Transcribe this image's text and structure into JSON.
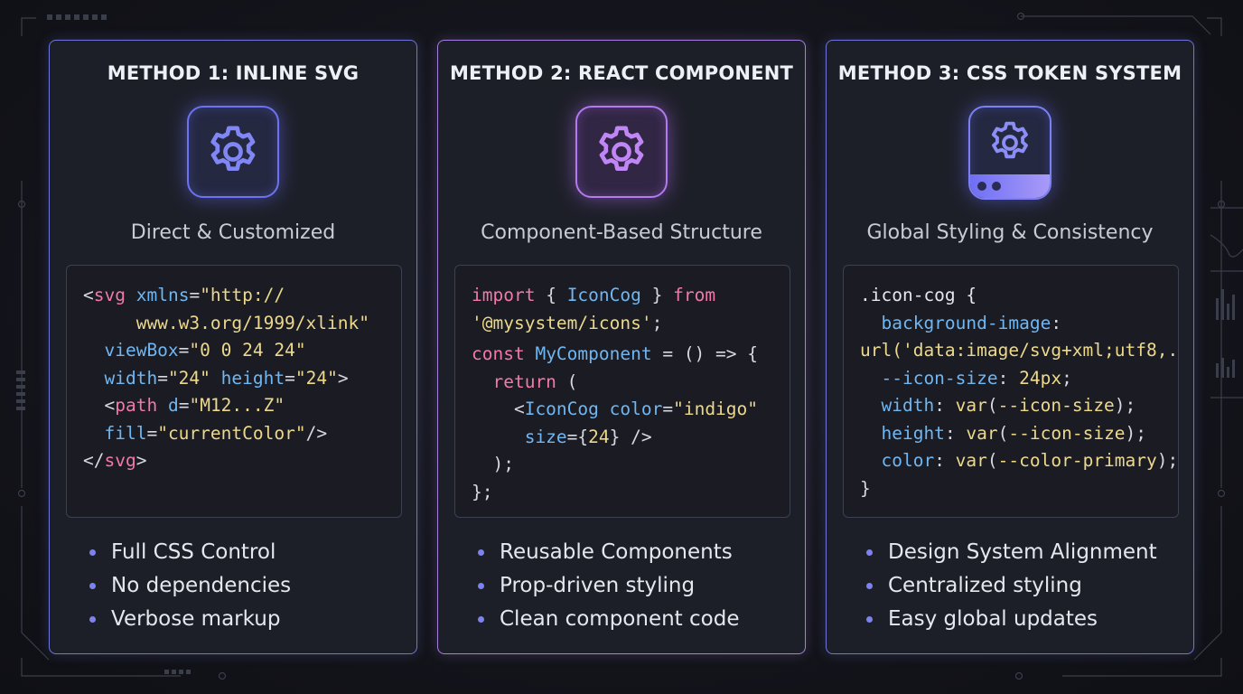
{
  "panels": [
    {
      "title": "METHOD 1: INLINE SVG",
      "icon": "gear-icon",
      "subtitle": "Direct & Customized",
      "bullets": [
        "Full CSS Control",
        "No dependencies",
        "Verbose markup"
      ]
    },
    {
      "title": "METHOD 2: REACT COMPONENT",
      "icon": "gear-icon",
      "subtitle": "Component-Based Structure",
      "bullets": [
        "Reusable Components",
        "Prop-driven styling",
        "Clean component code"
      ]
    },
    {
      "title": "METHOD 3: CSS TOKEN SYSTEM",
      "icon": "gear-window-icon",
      "subtitle": "Global Styling & Consistency",
      "bullets": [
        "Design System Alignment",
        "Centralized styling",
        "Easy global updates"
      ]
    }
  ],
  "code": {
    "p1": [
      [
        [
          "c-punc",
          "<"
        ],
        [
          "c-tag",
          "svg"
        ],
        [
          "c-punc",
          " "
        ],
        [
          "c-attr",
          "xmlns"
        ],
        [
          "c-punc",
          "="
        ],
        [
          "c-str",
          "\"http://"
        ]
      ],
      [
        [
          "c-str",
          "     www.w3.org/1999/xlink\""
        ]
      ],
      [
        [
          "c-punc",
          "  "
        ],
        [
          "c-attr",
          "viewBox"
        ],
        [
          "c-punc",
          "="
        ],
        [
          "c-str",
          "\"0 0 24 24\""
        ]
      ],
      [
        [
          "c-punc",
          "  "
        ],
        [
          "c-attr",
          "width"
        ],
        [
          "c-punc",
          "="
        ],
        [
          "c-str",
          "\"24\""
        ],
        [
          "c-punc",
          " "
        ],
        [
          "c-attr",
          "height"
        ],
        [
          "c-punc",
          "="
        ],
        [
          "c-str",
          "\"24\""
        ],
        [
          "c-punc",
          ">"
        ]
      ],
      [
        [
          "c-punc",
          "  <"
        ],
        [
          "c-tag",
          "path"
        ],
        [
          "c-punc",
          " "
        ],
        [
          "c-attr",
          "d"
        ],
        [
          "c-punc",
          "="
        ],
        [
          "c-str",
          "\"M12...Z\""
        ]
      ],
      [
        [
          "c-punc",
          "  "
        ],
        [
          "c-attr",
          "fill"
        ],
        [
          "c-punc",
          "="
        ],
        [
          "c-str",
          "\"currentColor\""
        ],
        [
          "c-punc",
          "/>"
        ]
      ],
      [
        [
          "c-punc",
          "</"
        ],
        [
          "c-tag",
          "svg"
        ],
        [
          "c-punc",
          ">"
        ]
      ]
    ],
    "p2": [
      [
        [
          "c-kw",
          "import"
        ],
        [
          "c-punc",
          " { "
        ],
        [
          "c-id",
          "IconCog"
        ],
        [
          "c-punc",
          " } "
        ],
        [
          "c-kw",
          "from"
        ]
      ],
      [
        [
          "c-str",
          "'@mysystem/icons'"
        ],
        [
          "c-punc",
          ";"
        ]
      ],
      "gap",
      [
        [
          "c-kw",
          "const"
        ],
        [
          "c-punc",
          " "
        ],
        [
          "c-id",
          "MyComponent"
        ],
        [
          "c-punc",
          " = () => {"
        ]
      ],
      [
        [
          "c-punc",
          "  "
        ],
        [
          "c-kw",
          "return"
        ],
        [
          "c-punc",
          " ("
        ]
      ],
      [
        [
          "c-punc",
          "    <"
        ],
        [
          "c-id",
          "IconCog"
        ],
        [
          "c-punc",
          " "
        ],
        [
          "c-attr",
          "color"
        ],
        [
          "c-punc",
          "="
        ],
        [
          "c-str",
          "\"indigo\""
        ]
      ],
      [
        [
          "c-punc",
          "     "
        ],
        [
          "c-attr",
          "size"
        ],
        [
          "c-punc",
          "={"
        ],
        [
          "c-str",
          "24"
        ],
        [
          "c-punc",
          "} />"
        ]
      ],
      [
        [
          "c-punc",
          "  );"
        ]
      ],
      [
        [
          "c-punc",
          "};"
        ]
      ]
    ],
    "p3": [
      [
        [
          "c-sel",
          ".icon-cog {"
        ]
      ],
      [
        [
          "c-punc",
          "  "
        ],
        [
          "c-prop",
          "background-image"
        ],
        [
          "c-punc",
          ":"
        ]
      ],
      [
        [
          "c-str",
          "url('data:image/svg+xml;utf8,.."
        ]
      ],
      [
        [
          "c-punc",
          "  "
        ],
        [
          "c-prop",
          "--icon-size"
        ],
        [
          "c-punc",
          ": "
        ],
        [
          "c-str",
          "24px"
        ],
        [
          "c-punc",
          ";"
        ]
      ],
      [
        [
          "c-punc",
          "  "
        ],
        [
          "c-prop",
          "width"
        ],
        [
          "c-punc",
          ": "
        ],
        [
          "c-str",
          "var"
        ],
        [
          "c-punc",
          "("
        ],
        [
          "c-str",
          "--icon-size"
        ],
        [
          "c-punc",
          ");"
        ]
      ],
      [
        [
          "c-punc",
          "  "
        ],
        [
          "c-prop",
          "height"
        ],
        [
          "c-punc",
          ": "
        ],
        [
          "c-str",
          "var"
        ],
        [
          "c-punc",
          "("
        ],
        [
          "c-str",
          "--icon-size"
        ],
        [
          "c-punc",
          ");"
        ]
      ],
      [
        [
          "c-punc",
          "  "
        ],
        [
          "c-prop",
          "color"
        ],
        [
          "c-punc",
          ": "
        ],
        [
          "c-str",
          "var"
        ],
        [
          "c-punc",
          "("
        ],
        [
          "c-str",
          "--color-primary"
        ],
        [
          "c-punc",
          ");"
        ]
      ],
      [
        [
          "c-punc",
          "}"
        ]
      ]
    ]
  },
  "colors": {
    "accent_indigo": "#6f74d8",
    "accent_purple": "#a67ee0",
    "background": "#14151c"
  }
}
